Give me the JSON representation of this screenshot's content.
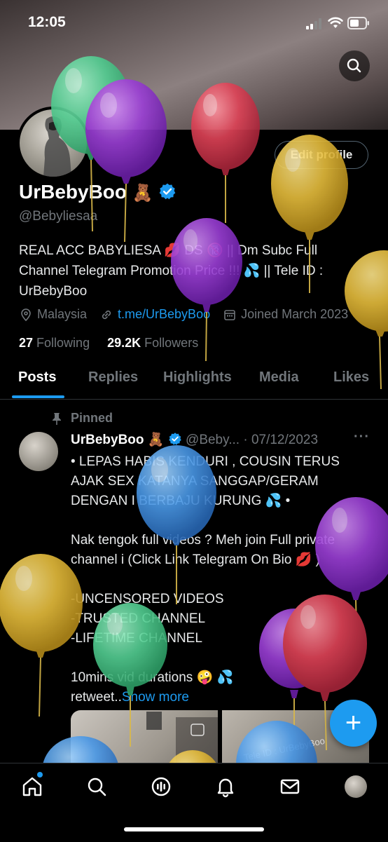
{
  "status": {
    "time": "12:05"
  },
  "profile": {
    "name": "UrBebyBoo",
    "name_emoji": "🧸",
    "handle": "@Bebyliesaa",
    "edit_label": "Edit profile",
    "bio_lines": [
      "REAL ACC BABYLIESA 💋 DS 🔞 || Dm Subc Full",
      "Channel Telegram Promotion Price !!! 💦 || Tele ID :",
      "UrBebyBoo"
    ],
    "location": "Malaysia",
    "link": "t.me/UrBebyBoo",
    "joined": "Joined March 2023",
    "following_count": "27",
    "following_label": "Following",
    "followers_count": "29.2K",
    "followers_label": "Followers"
  },
  "tabs": [
    "Posts",
    "Replies",
    "Highlights",
    "Media",
    "Likes"
  ],
  "post": {
    "pinned_label": "Pinned",
    "author": "UrBebyBoo",
    "author_emoji": "🧸",
    "handle": "@Beby...",
    "date": "· 07/12/2023",
    "more": "···",
    "lines": [
      "• LEPAS HABIS KENDURI , COUSIN TERUS",
      "AJAK SEX KATANYA SANGGAP/GERAM",
      "DENGAN I BERBAJU KURUNG 💦 •",
      "",
      "Nak tengok full videos ? Meh join Full private",
      "channel i (Click Link Telegram On Bio 💋 )",
      "",
      "-UNCENSORED VIDEOS",
      "-TRUSTED CHANNEL",
      "-LIFETIME CHANNEL",
      "",
      "10mins vid durations 🤪 💦"
    ],
    "last_line": "retweet..",
    "show_more": "Show more",
    "media_watermark": "Tele ID : UrBebyBoo"
  },
  "fab_label": "+",
  "nav_icons": [
    "home-icon",
    "search-icon",
    "spaces-icon",
    "notifications-icon",
    "messages-icon",
    "avatar"
  ],
  "colors": {
    "accent": "#1d9bf0",
    "muted": "#71767b",
    "background": "#000000"
  }
}
